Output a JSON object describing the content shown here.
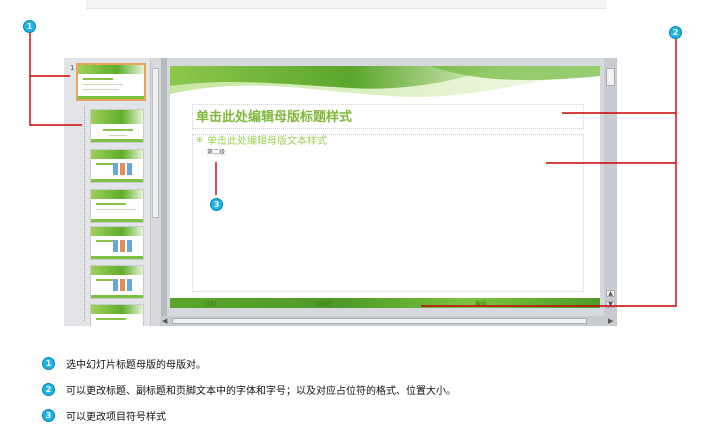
{
  "callouts": {
    "one": "1",
    "two": "2",
    "three": "3"
  },
  "slide_master": {
    "thumbnail_number": "1",
    "title_placeholder": "单击此处编辑母版标题样式",
    "body_placeholder": "单击此处编辑母版文本样式",
    "level2": "第二级",
    "footer_left": "日期",
    "footer_center": "页脚区",
    "footer_right": "编号",
    "bullet_glyph": "⊕"
  },
  "legend": [
    {
      "num": "1",
      "text": "选中幻灯片标题母版的母版对。"
    },
    {
      "num": "2",
      "text": "可以更改标题、副标题和页脚文本中的字体和字号；以及对应占位符的格式、位置大小。"
    },
    {
      "num": "3",
      "text": "可以更改项目符号样式"
    }
  ],
  "colors": {
    "callout": "#1fb5e8",
    "callout_line": "#cc0000",
    "theme_green": "#7fb83a",
    "selected_border": "#e8a35a"
  }
}
